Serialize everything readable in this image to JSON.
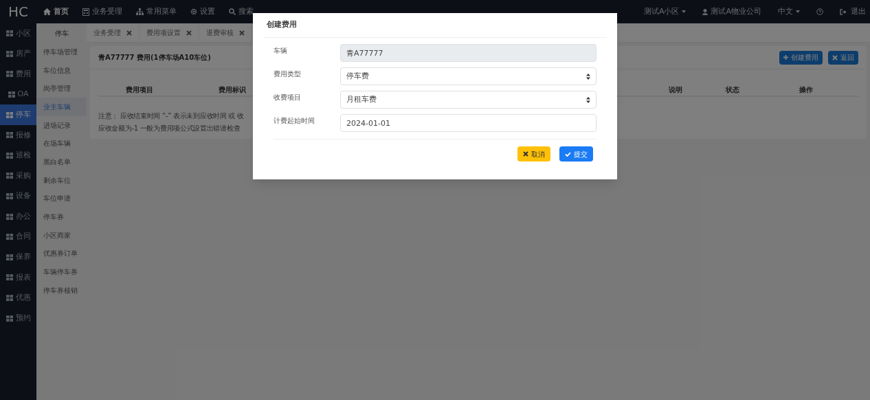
{
  "top_nav": {
    "logo": "HC",
    "items": [
      {
        "label": "首页",
        "selected": true
      },
      {
        "label": "业务受理",
        "selected": false
      },
      {
        "label": "常用菜单",
        "selected": false
      },
      {
        "label": "设置",
        "selected": false
      },
      {
        "label": "搜索",
        "selected": false
      }
    ],
    "right": {
      "community": "测试A小区",
      "company": "测试A物业公司",
      "language": "中文",
      "logout": "退出"
    }
  },
  "sidebar": {
    "items": [
      {
        "label": "小区",
        "selected": false
      },
      {
        "label": "房产",
        "selected": false
      },
      {
        "label": "费用",
        "selected": false
      },
      {
        "label": "OA",
        "selected": false
      },
      {
        "label": "停车",
        "selected": true
      },
      {
        "label": "报修",
        "selected": false
      },
      {
        "label": "巡检",
        "selected": false
      },
      {
        "label": "采购",
        "selected": false
      },
      {
        "label": "设备",
        "selected": false
      },
      {
        "label": "办公",
        "selected": false
      },
      {
        "label": "合同",
        "selected": false
      },
      {
        "label": "保养",
        "selected": false
      },
      {
        "label": "报表",
        "selected": false
      },
      {
        "label": "优惠",
        "selected": false
      },
      {
        "label": "预约",
        "selected": false
      }
    ]
  },
  "submenu": {
    "title": "停车",
    "items": [
      {
        "label": "停车场管理",
        "selected": false
      },
      {
        "label": "车位信息",
        "selected": false
      },
      {
        "label": "岗亭管理",
        "selected": false
      },
      {
        "label": "业主车辆",
        "selected": true
      },
      {
        "label": "进场记录",
        "selected": false
      },
      {
        "label": "在场车辆",
        "selected": false
      },
      {
        "label": "黑白名单",
        "selected": false
      },
      {
        "label": "剩余车位",
        "selected": false
      },
      {
        "label": "车位申请",
        "selected": false
      },
      {
        "label": "停车券",
        "selected": false
      },
      {
        "label": "小区商家",
        "selected": false
      },
      {
        "label": "优惠券订单",
        "selected": false
      },
      {
        "label": "车辆停车券",
        "selected": false
      },
      {
        "label": "停车券核销",
        "selected": false
      }
    ]
  },
  "tabs": [
    {
      "label": "业务受理"
    },
    {
      "label": "费用项设置"
    },
    {
      "label": "退费审核"
    }
  ],
  "panel": {
    "title": "青A77777 费用(1停车场A10车位)",
    "buttons": [
      "创建费用",
      "返回"
    ],
    "columns": [
      "费用项目",
      "费用标识",
      "说明",
      "状态",
      "操作"
    ],
    "notes": [
      "注意： 应收结束时间 “-” 表示未到应收时间 或 收",
      "应收金额为-1 一般为费用项公式设置出错请检查"
    ]
  },
  "dialog": {
    "title": "创建费用",
    "fields": [
      {
        "label": "车辆",
        "kind": "readonly",
        "value": "青A77777"
      },
      {
        "label": "费用类型",
        "kind": "select",
        "value": "停车费"
      },
      {
        "label": "收费项目",
        "kind": "select",
        "value": "月租车费"
      },
      {
        "label": "计费起始时间",
        "kind": "input",
        "value": "2024-01-01"
      }
    ],
    "cancel": "取消",
    "submit": "提交"
  }
}
